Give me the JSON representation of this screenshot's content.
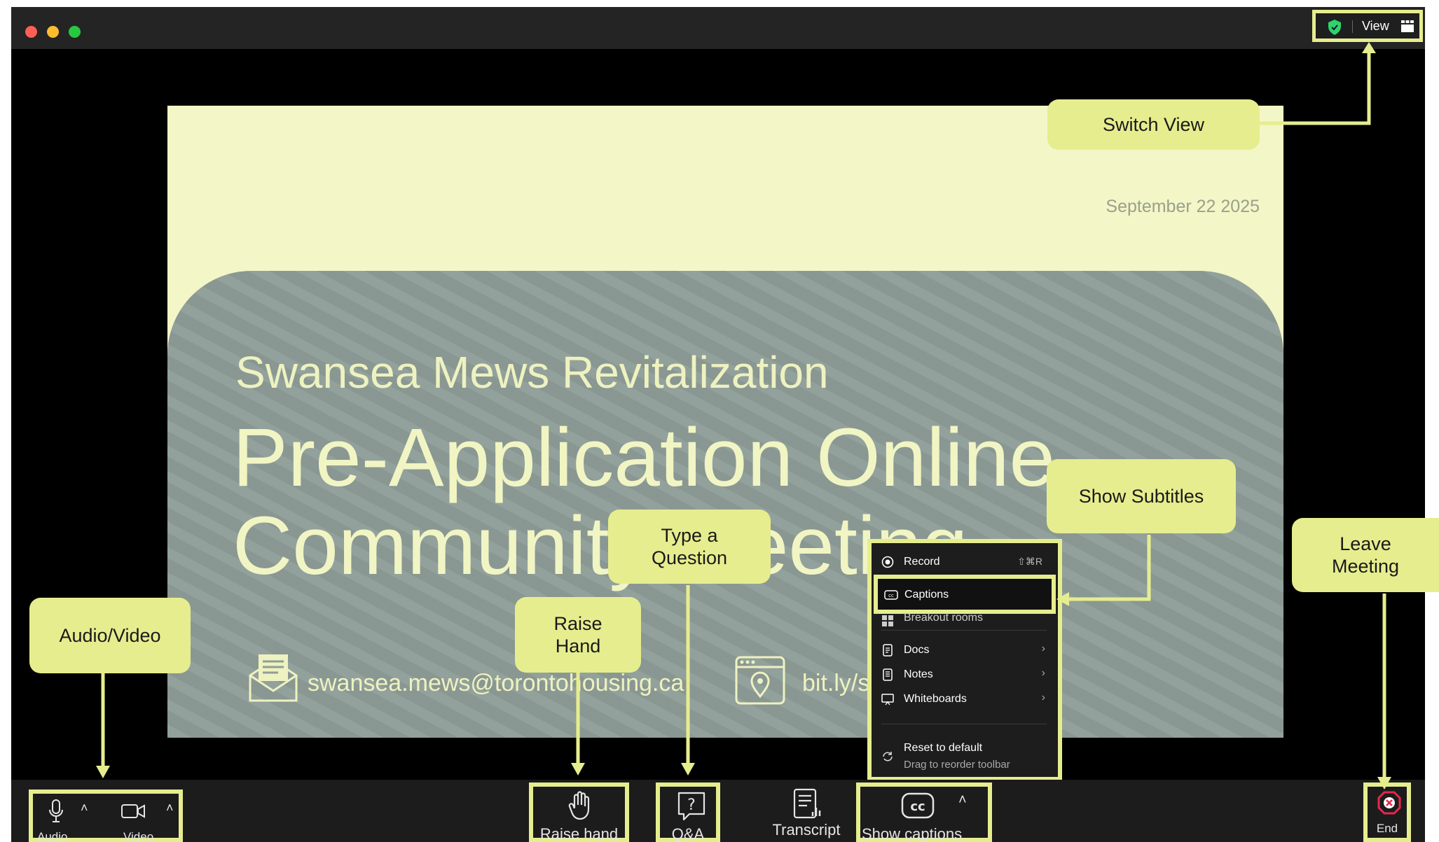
{
  "window": {
    "traffic_lights": [
      "#ff5f57",
      "#febc2e",
      "#28c840"
    ],
    "view_button": {
      "label": "View",
      "shield_color": "#2fd36b"
    }
  },
  "slide": {
    "date": "September 22 2025",
    "subtitle": "Swansea Mews Revitalization",
    "title_line1": "Pre-Application Online",
    "title_line2": "Community Meeting",
    "email": "swansea.mews@torontohousing.ca",
    "link": "bit.ly/s"
  },
  "menu": {
    "items": [
      {
        "icon": "record-icon",
        "label": "Record",
        "shortcut": "⇧⌘R"
      },
      {
        "icon": "cc-icon",
        "label": "Captions"
      },
      {
        "icon": "breakout-rooms-icon",
        "label": "Breakout rooms"
      },
      {
        "icon": "docs-icon",
        "label": "Docs"
      },
      {
        "icon": "notes-icon",
        "label": "Notes"
      },
      {
        "icon": "whiteboard-icon",
        "label": "Whiteboards"
      }
    ],
    "reset": {
      "label": "Reset to default",
      "hint": "Drag to reorder toolbar"
    }
  },
  "toolbar": {
    "audio": "Audio",
    "video": "Video",
    "raise_hand": "Raise hand",
    "qa": "Q&A",
    "transcript": "Transcript",
    "show_captions": "Show captions",
    "end": "End"
  },
  "callouts": {
    "switch_view": "Switch View",
    "show_subtitles": "Show Subtitles",
    "type_question": "Type a\nQuestion",
    "raise_hand": "Raise\nHand",
    "audio_video": "Audio/Video",
    "leave_meeting": "Leave\nMeeting"
  },
  "colors": {
    "highlight": "#e6ed8e",
    "slide_bg": "#f3f6c6",
    "end_red": "#e8274b"
  }
}
